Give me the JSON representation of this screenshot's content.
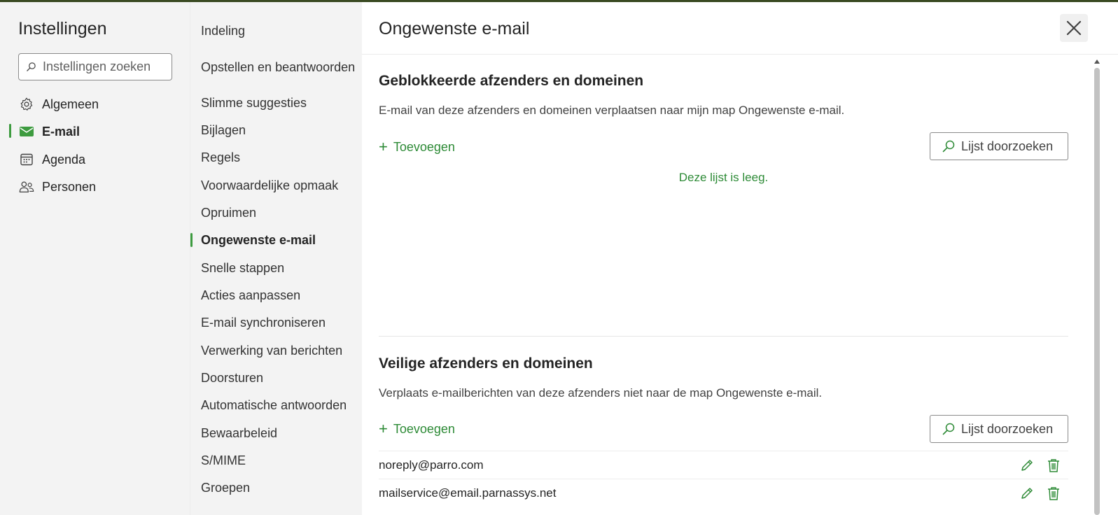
{
  "settings": {
    "title": "Instellingen",
    "search_placeholder": "Instellingen zoeken"
  },
  "nav": {
    "items": [
      {
        "label": "Algemeen",
        "icon": "gear-icon"
      },
      {
        "label": "E-mail",
        "icon": "mail-icon",
        "active": true
      },
      {
        "label": "Agenda",
        "icon": "calendar-icon"
      },
      {
        "label": "Personen",
        "icon": "people-icon"
      }
    ]
  },
  "submenu": {
    "items": [
      "Indeling",
      "Opstellen en beantwoorden",
      "Slimme suggesties",
      "Bijlagen",
      "Regels",
      "Voorwaardelijke opmaak",
      "Opruimen",
      "Ongewenste e-mail",
      "Snelle stappen",
      "Acties aanpassen",
      "E-mail synchroniseren",
      "Verwerking van berichten",
      "Doorsturen",
      "Automatische antwoorden",
      "Bewaarbeleid",
      "S/MIME",
      "Groepen"
    ],
    "active_index": 7
  },
  "panel": {
    "title": "Ongewenste e-mail",
    "blocked": {
      "title": "Geblokkeerde afzenders en domeinen",
      "description": "E-mail van deze afzenders en domeinen verplaatsen naar mijn map Ongewenste e-mail.",
      "add_label": "Toevoegen",
      "search_label": "Lijst doorzoeken",
      "empty_message": "Deze lijst is leeg."
    },
    "safe": {
      "title": "Veilige afzenders en domeinen",
      "description": "Verplaats e-mailberichten van deze afzenders niet naar de map Ongewenste e-mail.",
      "add_label": "Toevoegen",
      "search_label": "Lijst doorzoeken",
      "entries": [
        "noreply@parro.com",
        "mailservice@email.parnassys.net"
      ]
    }
  },
  "colors": {
    "accent": "#3d9b3f",
    "link_green": "#2e8b37"
  }
}
